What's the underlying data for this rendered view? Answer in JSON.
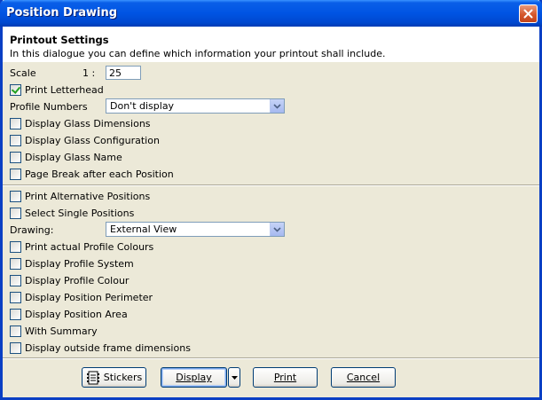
{
  "window": {
    "title": "Position Drawing"
  },
  "header": {
    "title": "Printout Settings",
    "description": "In this dialogue you can define which information your printout shall include."
  },
  "scale": {
    "label": "Scale",
    "prefix": "1 :",
    "value": "25"
  },
  "section1": {
    "print_letterhead": {
      "label": "Print Letterhead",
      "checked": true
    },
    "profile_numbers": {
      "label": "Profile Numbers",
      "selected": "Don't display"
    },
    "checkboxes": [
      {
        "label": "Display Glass Dimensions",
        "checked": false
      },
      {
        "label": "Display Glass Configuration",
        "checked": false
      },
      {
        "label": "Display Glass Name",
        "checked": false
      },
      {
        "label": "Page Break after each Position",
        "checked": false
      }
    ]
  },
  "section2": {
    "top_checkboxes": [
      {
        "label": "Print Alternative Positions",
        "checked": false
      },
      {
        "label": "Select Single Positions",
        "checked": false
      }
    ],
    "drawing": {
      "label": "Drawing:",
      "selected": "External View"
    },
    "checkboxes": [
      {
        "label": "Print actual Profile Colours",
        "checked": false
      },
      {
        "label": "Display Profile System",
        "checked": false
      },
      {
        "label": "Display Profile Colour",
        "checked": false
      },
      {
        "label": "Display Position Perimeter",
        "checked": false
      },
      {
        "label": "Display Position Area",
        "checked": false
      },
      {
        "label": "With Summary",
        "checked": false
      },
      {
        "label": "Display outside frame dimensions",
        "checked": false
      }
    ]
  },
  "buttons": {
    "stickers": {
      "label": "Stickers",
      "icon": "stickers-icon"
    },
    "display": {
      "label": "Display"
    },
    "print": {
      "label": "Print"
    },
    "cancel": {
      "label": "Cancel"
    }
  }
}
